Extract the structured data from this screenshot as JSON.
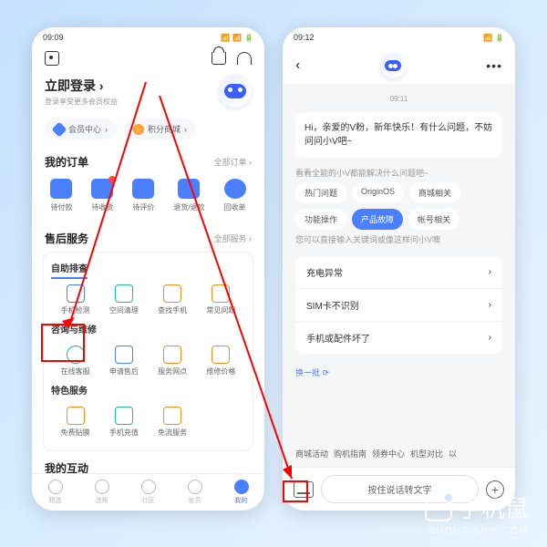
{
  "phone1": {
    "status_time": "09:09",
    "login_title": "立即登录",
    "login_arrow": "›",
    "login_sub": "登录享受更多会员权益",
    "pill_member": "会员中心",
    "pill_points": "积分商城",
    "orders_title": "我的订单",
    "orders_more": "全部订单 ›",
    "order_items": [
      "待付款",
      "待收货",
      "待评价",
      "退货/退款",
      "回收单"
    ],
    "service_title": "售后服务",
    "service_more": "全部服务 ›",
    "card1_label": "自助排查",
    "card1_items": [
      "手机检测",
      "空间清理",
      "查找手机",
      "常见问题"
    ],
    "card2_label": "咨询与维修",
    "card2_items": [
      "在线客服",
      "申请售后",
      "服务网点",
      "维修价格"
    ],
    "card3_label": "特色服务",
    "card3_items": [
      "免费贴膜",
      "手机充值",
      "免流服务"
    ],
    "interact_title": "我的互动",
    "tabs": [
      "精选",
      "选购",
      "社区",
      "会员",
      "我的"
    ]
  },
  "phone2": {
    "status_time": "09:12",
    "msg_time": "09:11",
    "greeting": "Hi，亲爱的V粉，新年快乐！有什么问题，不妨问问小V吧~",
    "sug_intro": "看看全能的小V都能解决什么问题吧~",
    "chips": [
      "热门问题",
      "OriginOS",
      "商城相关",
      "功能操作",
      "产品故障",
      "帐号相关"
    ],
    "active_chip_index": 4,
    "kw_hint": "您可以直接输入关键词或像这样问小V噢",
    "faq": [
      "充电异常",
      "SIM卡不识别",
      "手机或配件坏了"
    ],
    "refresh": "换一批 ⟳",
    "quick": [
      "商城活动",
      "购机指南",
      "领券中心",
      "机型对比",
      "以"
    ],
    "voice_label": "按住说话转文字"
  },
  "watermark": {
    "main": "手机鼠",
    "sub": "SHOUJISHU.COM"
  }
}
